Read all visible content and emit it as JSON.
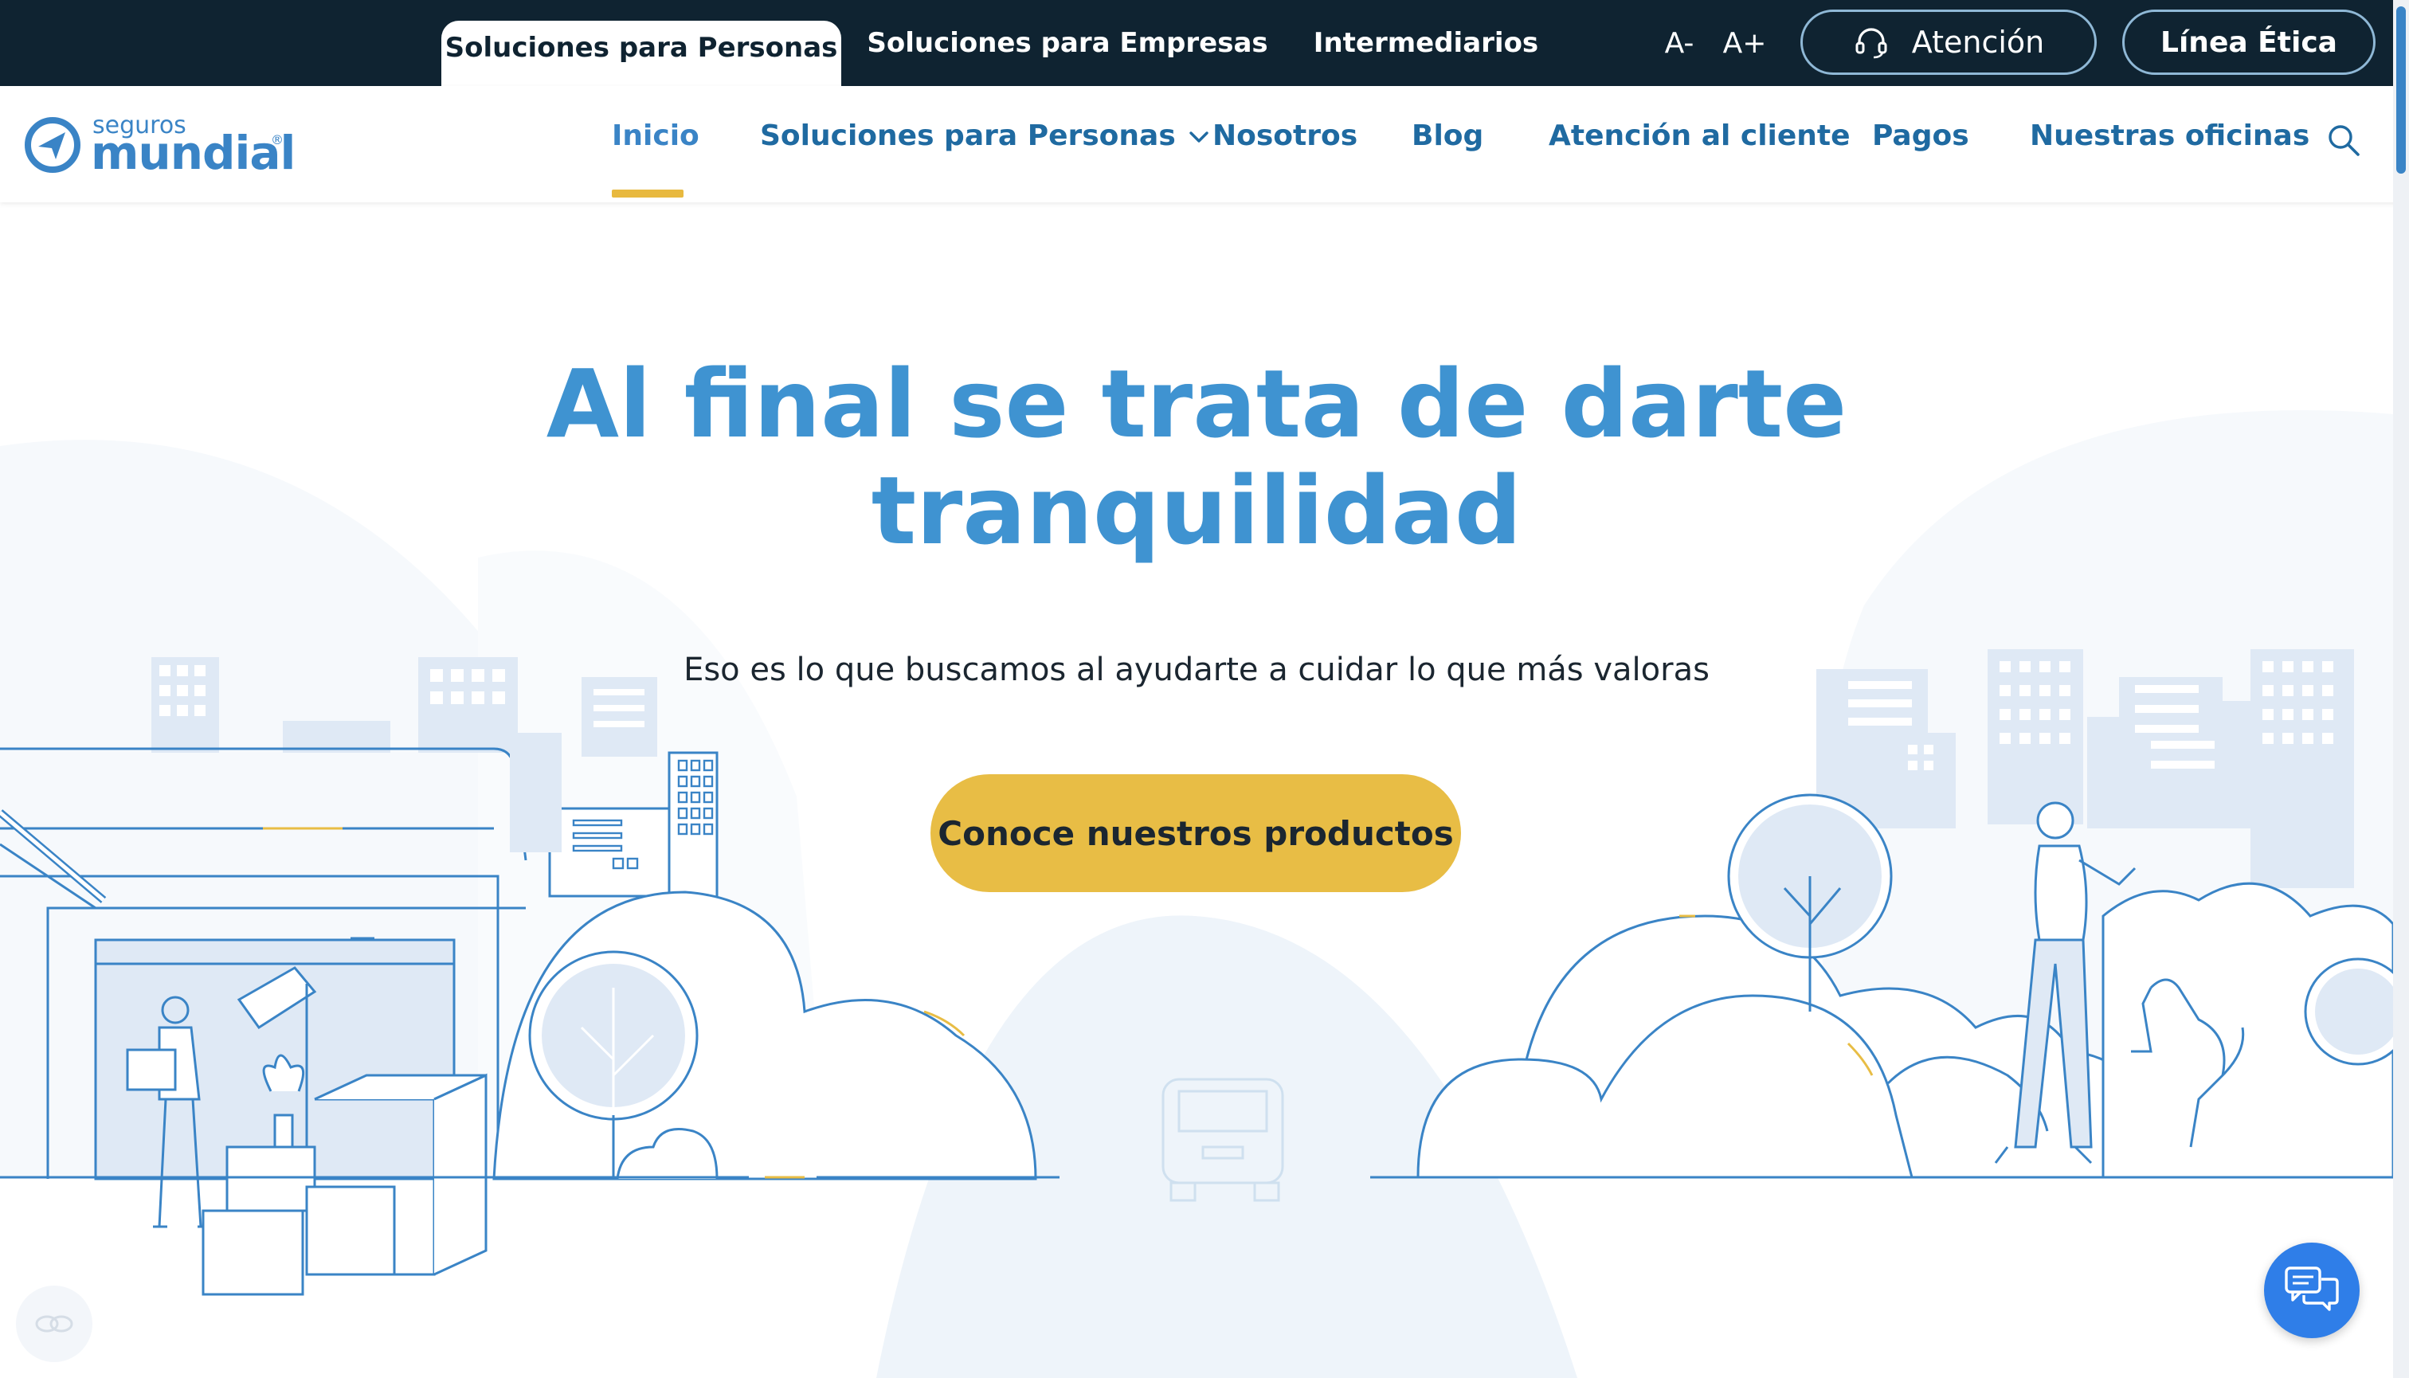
{
  "topbar": {
    "segments": [
      {
        "label": "Soluciones para Personas",
        "active": true
      },
      {
        "label": "Soluciones para Empresas",
        "active": false
      },
      {
        "label": "Intermediarios",
        "active": false
      }
    ],
    "font_decrease": "A-",
    "font_increase": "A+",
    "attention_label": "Atención",
    "ethics_label": "Línea Ética"
  },
  "brand": {
    "line1": "seguros",
    "line2": "mundial",
    "reg": "®"
  },
  "nav": {
    "items": [
      {
        "label": "Inicio",
        "active": true
      },
      {
        "label": "Soluciones para Personas",
        "dropdown": true
      },
      {
        "label": "Nosotros"
      },
      {
        "label": "Blog"
      },
      {
        "label": "Atención al cliente"
      },
      {
        "label": "Pagos"
      },
      {
        "label": "Nuestras oficinas"
      }
    ]
  },
  "hero": {
    "title_line1": "Al final se trata de darte",
    "title_line2": "tranquilidad",
    "subtitle": "Eso es lo que buscamos al ayudarte a cuidar lo que más valoras",
    "cta_label": "Conoce nuestros productos"
  },
  "colors": {
    "topbar_bg": "#0f2331",
    "brand_blue": "#3a84c6",
    "nav_text": "#1f6aa1",
    "accent_yellow": "#e8bd45",
    "chat_blue": "#2f7ee8"
  },
  "icons": {
    "attention": "headset-icon",
    "search": "search-icon",
    "chat": "chat-icon",
    "accessibility": "accessibility-icon",
    "dropdown": "chevron-down-icon"
  }
}
